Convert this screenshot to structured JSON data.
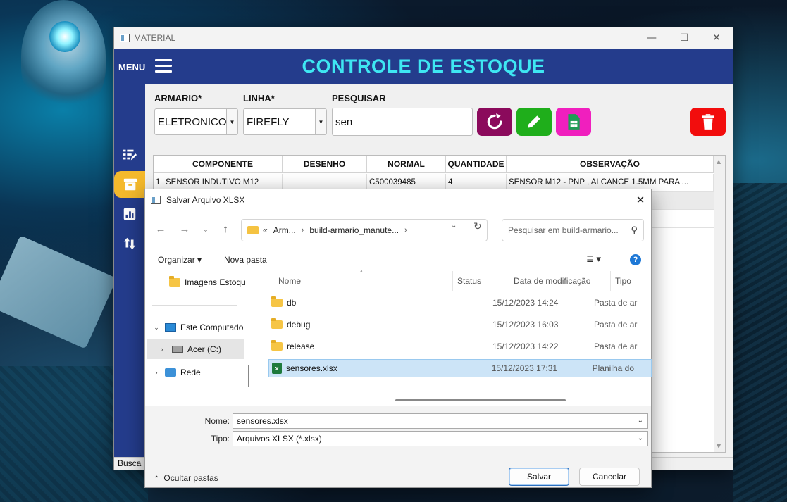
{
  "main_window": {
    "title": "MATERIAL",
    "controls": {
      "minimize": "—",
      "maximize": "☐",
      "close": "✕"
    },
    "menu_label": "MENU",
    "app_title": "CONTROLE DE ESTOQUE",
    "filters": {
      "armario_label": "ARMARIO*",
      "armario_value": "ELETRONICO",
      "linha_label": "LINHA*",
      "linha_value": "FIREFLY",
      "pesquisar_label": "PESQUISAR",
      "pesquisar_value": "sen"
    },
    "action_colors": {
      "refresh": "#8b0a5c",
      "edit": "#1fae1b",
      "export": "#f01fbe",
      "delete": "#f20d0d"
    },
    "sidebar_items": [
      "edit-list-icon",
      "archive-icon",
      "chart-icon",
      "transfer-icon"
    ],
    "table": {
      "columns": [
        "COMPONENTE",
        "DESENHO",
        "NORMAL",
        "QUANTIDADE",
        "OBSERVAÇÃO"
      ],
      "rows": [
        {
          "index": "1",
          "componente": "SENSOR INDUTIVO M12",
          "desenho": "",
          "normal": "C500039485",
          "quantidade": "4",
          "observacao": "SENSOR M12 - PNP , ALCANCE 1.5MM PARA ..."
        }
      ]
    },
    "status_text": "Busca r"
  },
  "save_dialog": {
    "title": "Salvar Arquivo XLSX",
    "close": "✕",
    "path": {
      "prefix": "«",
      "part1": "Arm...",
      "part2": "build-armario_manute..."
    },
    "search_placeholder": "Pesquisar em build-armario...",
    "toolbar": {
      "organize": "Organizar ▾",
      "new_folder": "Nova pasta",
      "help": "?"
    },
    "nav": {
      "images_folder": "Imagens Estoqu",
      "this_pc": "Este Computado",
      "drive": "Acer (C:)",
      "network": "Rede"
    },
    "columns": {
      "name": "Nome",
      "status": "Status",
      "modified": "Data de modificação",
      "type": "Tipo"
    },
    "files": [
      {
        "name": "db",
        "date": "15/12/2023 14:24",
        "type": "Pasta de ar",
        "kind": "folder"
      },
      {
        "name": "debug",
        "date": "15/12/2023 16:03",
        "type": "Pasta de ar",
        "kind": "folder"
      },
      {
        "name": "release",
        "date": "15/12/2023 14:22",
        "type": "Pasta de ar",
        "kind": "folder"
      },
      {
        "name": "sensores.xlsx",
        "date": "15/12/2023 17:31",
        "type": "Planilha do",
        "kind": "xlsx"
      }
    ],
    "filename_label": "Nome:",
    "filename_value": "sensores.xlsx",
    "filetype_label": "Tipo:",
    "filetype_value": "Arquivos XLSX (*.xlsx)",
    "hide_folders": "Ocultar pastas",
    "save_button": "Salvar",
    "cancel_button": "Cancelar"
  }
}
